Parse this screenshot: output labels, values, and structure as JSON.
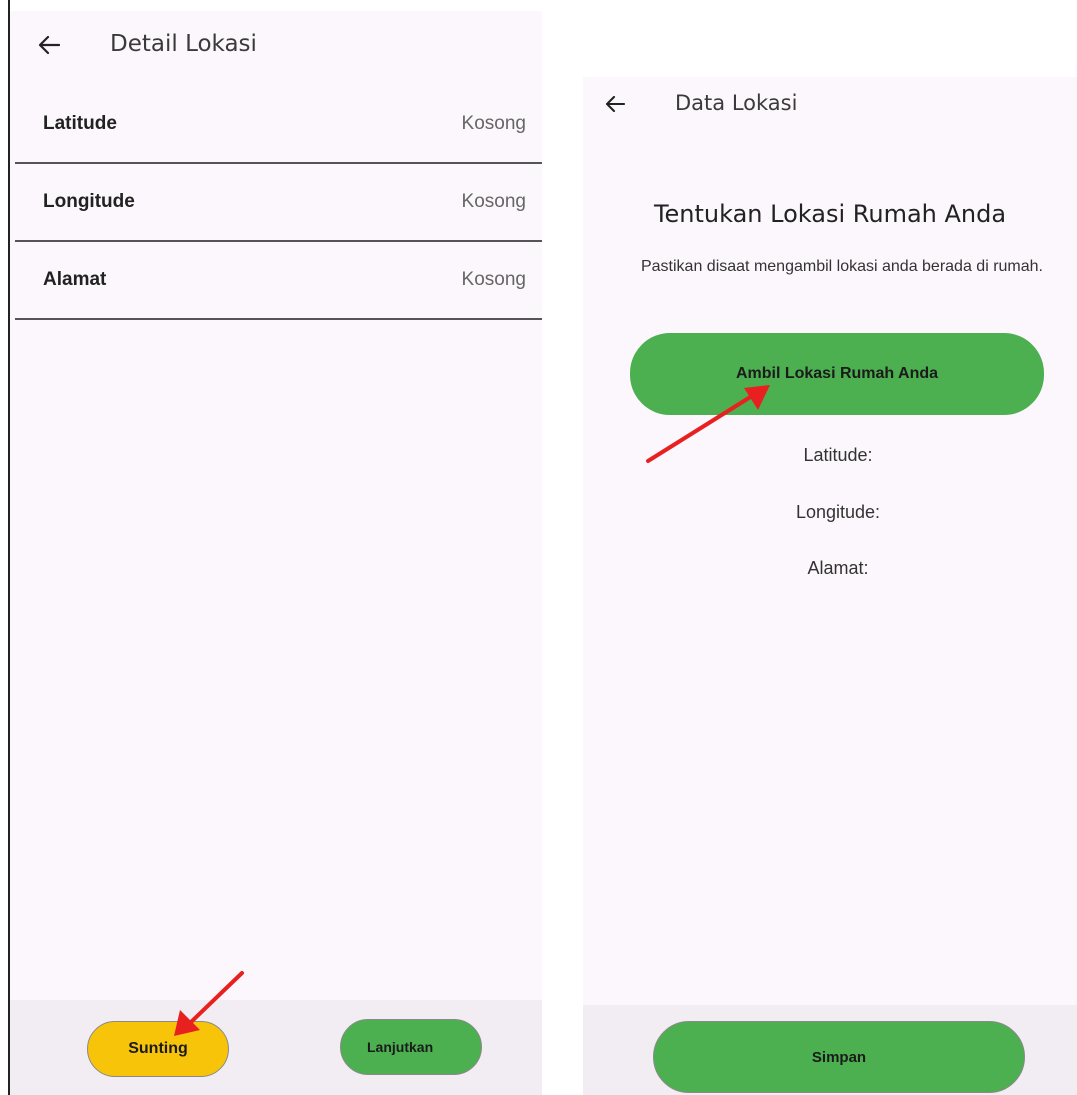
{
  "left_screen": {
    "title": "Detail Lokasi",
    "rows": [
      {
        "label": "Latitude",
        "value": "Kosong"
      },
      {
        "label": "Longitude",
        "value": "Kosong"
      },
      {
        "label": "Alamat",
        "value": "Kosong"
      }
    ],
    "buttons": {
      "edit": "Sunting",
      "continue": "Lanjutkan"
    }
  },
  "right_screen": {
    "title": "Data Lokasi",
    "heading": "Tentukan Lokasi Rumah Anda",
    "subheading": "Pastikan disaat mengambil lokasi anda berada di rumah.",
    "get_location_button": "Ambil Lokasi Rumah Anda",
    "fields": {
      "latitude": "Latitude:",
      "longitude": "Longitude:",
      "address": "Alamat:"
    },
    "save_button": "Simpan"
  },
  "colors": {
    "screen_bg": "#fcf7fc",
    "bottom_bar": "#f1edf2",
    "green": "#4caf50",
    "yellow": "#f8c40a",
    "annotation_arrow": "#e8201f"
  },
  "icons": {
    "back": "arrow-left-icon",
    "annotation": "red-arrow-annotation"
  }
}
